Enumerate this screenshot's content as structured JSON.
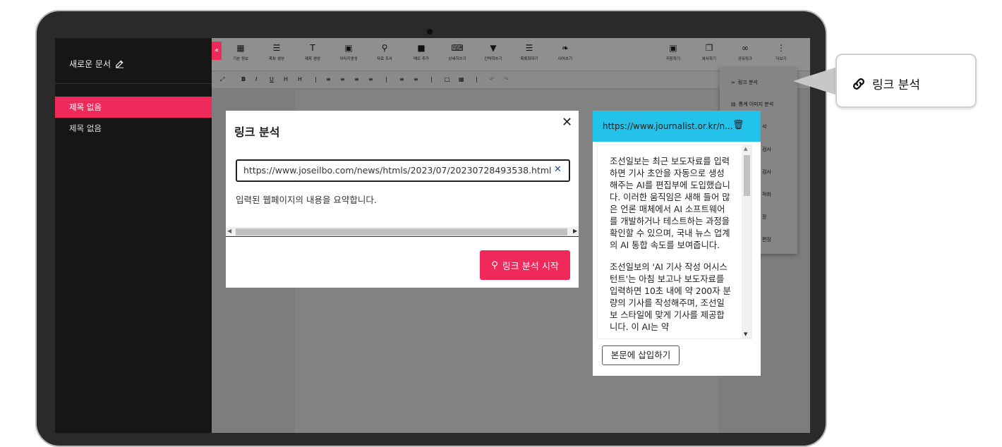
{
  "sidebar": {
    "new_doc_label": "새로운 문서",
    "documents": [
      "제목 없음",
      "제목 없음"
    ]
  },
  "toolbar": {
    "left_tools": [
      {
        "label": "기본 정보",
        "icon": "document-info-icon"
      },
      {
        "label": "목차 생성",
        "icon": "list-numbered-icon"
      },
      {
        "label": "제목 생성",
        "icon": "title-text-icon"
      },
      {
        "label": "이미지생성",
        "icon": "image-icon"
      },
      {
        "label": "자료 조사",
        "icon": "search-icon"
      },
      {
        "label": "메모 추가",
        "icon": "memo-icon"
      },
      {
        "label": "상세히쓰기",
        "icon": "keyboard-icon"
      },
      {
        "label": "간략히쓰기",
        "icon": "funnel-icon"
      },
      {
        "label": "목록화하기",
        "icon": "list-icon"
      },
      {
        "label": "이어쓰기",
        "icon": "feather-icon"
      }
    ],
    "right_tools": [
      {
        "label": "저장하기",
        "icon": "save-icon"
      },
      {
        "label": "복사하기",
        "icon": "copy-icon"
      },
      {
        "label": "공유링크",
        "icon": "link-icon"
      },
      {
        "label": "더보기",
        "icon": "more-vertical-icon"
      }
    ]
  },
  "dropdown": {
    "items": [
      "링크 분석",
      "통계 이미지 분석",
      "석",
      "검사",
      "검사",
      "적화",
      "장",
      "편장"
    ]
  },
  "modal": {
    "title": "링크 분석",
    "url_value": "https://www.joseilbo.com/news/htmls/2023/07/20230728493538.html",
    "description": "입력된 웹페이지의 내용을 요약합니다.",
    "start_button": "링크 분석 시작"
  },
  "result_panel": {
    "url": "https://www.journalist.or.kr/n...",
    "paragraphs": [
      "조선일보는 최근 보도자료를 입력하면 기사 초안을 자동으로 생성해주는 AI를 편집부에 도입했습니다. 이러한 움직임은 새해 들어 많은 언론 매체에서 AI 소프트웨어를 개발하거나 테스트하는 과정을 확인할 수 있으며, 국내 뉴스 업계의 AI 통합 속도를 보여줍니다.",
      "조선일보의 'AI 기사 작성 어시스턴트'는 아침 보고나 보도자료를 입력하면 10초 내에 약 200자 분량의 기사를 작성해주며, 조선일보 스타일에 맞게 기사를 제공합니다. 이 AI는 약"
    ],
    "insert_button": "본문에 삽입하기"
  },
  "callout": {
    "label": "링크 분석"
  },
  "colors": {
    "accent": "#f0295b",
    "panel_header": "#22c2ea"
  }
}
